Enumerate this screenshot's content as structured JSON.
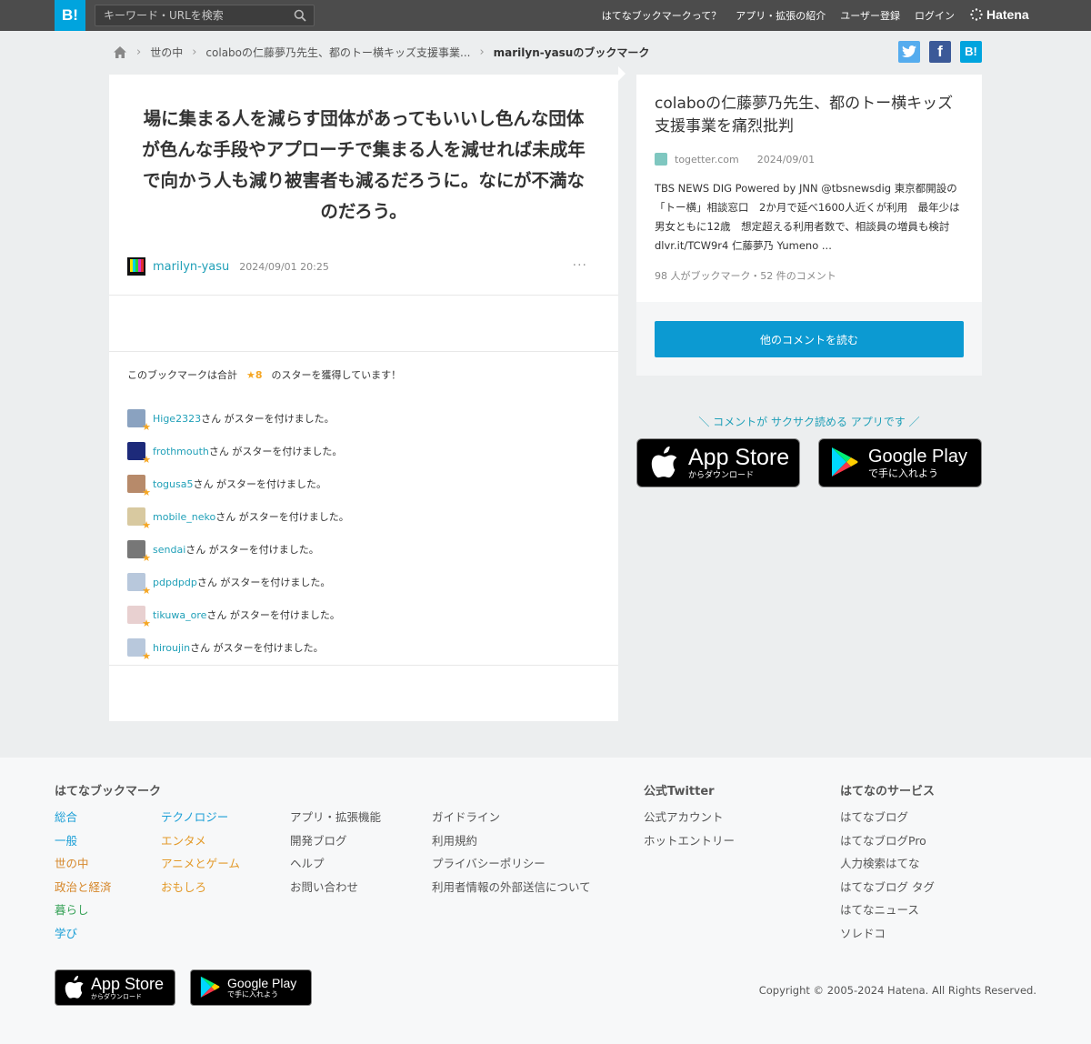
{
  "header": {
    "logo": "B!",
    "search_placeholder": "キーワード・URLを検索",
    "nav": [
      "はてなブックマークって？",
      "アプリ・拡張の紹介",
      "ユーザー登録",
      "ログイン"
    ],
    "brand": "Hatena"
  },
  "breadcrumb": {
    "items": [
      "世の中",
      "colaboの仁藤夢乃先生、都のトー横キッズ支援事業...",
      "marilyn-yasuのブックマーク"
    ]
  },
  "share": {
    "twitter": "t",
    "facebook": "f",
    "hatena": "B!"
  },
  "bookmark": {
    "comment": "場に集まる人を減らす団体があってもいいし色んな団体が色んな手段やアプローチで集まる人を減せれば未成年で向かう人も減り被害者も減るだろうに。なにが不満なのだろう。",
    "user": "marilyn-yasu",
    "date": "2024/09/01 20:25",
    "more": "···",
    "stars_prefix": "このブックマークは合計",
    "stars_count": "★8",
    "stars_suffix": "のスターを獲得しています！",
    "star_suffix_text": "さん がスターを付けました。",
    "stars": [
      {
        "user": "Hige2323",
        "color": "#8aa2c0"
      },
      {
        "user": "frothmouth",
        "color": "#1d2a7a"
      },
      {
        "user": "togusa5",
        "color": "#b78a6a"
      },
      {
        "user": "mobile_neko",
        "color": "#d8c9a0"
      },
      {
        "user": "sendai",
        "color": "#777777"
      },
      {
        "user": "pdpdpdp",
        "color": "#b8c8dc"
      },
      {
        "user": "tikuwa_ore",
        "color": "#e8d0d0"
      },
      {
        "user": "hiroujin",
        "color": "#b8c8dc"
      }
    ]
  },
  "entry": {
    "title": "colaboの仁藤夢乃先生、都のトー横キッズ支援事業を痛烈批判",
    "site": "togetter.com",
    "date": "2024/09/01",
    "description": "TBS NEWS DIG Powered by JNN @tbsnewsdig 東京都開設の「トー横」相談窓口　2か月で延べ1600人近くが利用　最年少は男女ともに12歳　想定超える利用者数で、相談員の増員も検討 dlvr.it/TCW9r4 仁藤夢乃 Yumeno ...",
    "counts": "98 人がブックマーク・52 件のコメント",
    "button": "他のコメントを読む"
  },
  "apps": {
    "promo": "＼ コメントが サクサク読める アプリです ／",
    "appstore_big": "App Store",
    "appstore_small": "からダウンロード",
    "googleplay_big": "Google Play",
    "googleplay_small": "で手に入れよう"
  },
  "footer": {
    "col1_title": "はてなブックマーク",
    "categories_a": [
      {
        "label": "総合",
        "color": "#1a9ed6"
      },
      {
        "label": "一般",
        "color": "#1a9ed6"
      },
      {
        "label": "世の中",
        "color": "#d6872a"
      },
      {
        "label": "政治と経済",
        "color": "#d6872a"
      },
      {
        "label": "暮らし",
        "color": "#3aa35a"
      },
      {
        "label": "学び",
        "color": "#1a9ed6"
      }
    ],
    "categories_b": [
      {
        "label": "テクノロジー",
        "color": "#1a9ed6"
      },
      {
        "label": "エンタメ",
        "color": "#e39a2a"
      },
      {
        "label": "アニメとゲーム",
        "color": "#e39a2a"
      },
      {
        "label": "おもしろ",
        "color": "#e39a2a"
      }
    ],
    "links_c": [
      "アプリ・拡張機能",
      "開発ブログ",
      "ヘルプ",
      "お問い合わせ"
    ],
    "links_d": [
      "ガイドライン",
      "利用規約",
      "プライバシーポリシー",
      "利用者情報の外部送信について"
    ],
    "twitter_title": "公式Twitter",
    "twitter_links": [
      "公式アカウント",
      "ホットエントリー"
    ],
    "services_title": "はてなのサービス",
    "services": [
      "はてなブログ",
      "はてなブログPro",
      "人力検索はてな",
      "はてなブログ タグ",
      "はてなニュース",
      "ソレドコ"
    ],
    "copyright": "Copyright © 2005-2024 Hatena. All Rights Reserved."
  },
  "colors": {
    "accent": "#00a4de",
    "link": "#20a0b8",
    "button": "#0c9ad2",
    "star": "#f5a623",
    "twitter": "#55acee",
    "facebook": "#3b5998"
  }
}
